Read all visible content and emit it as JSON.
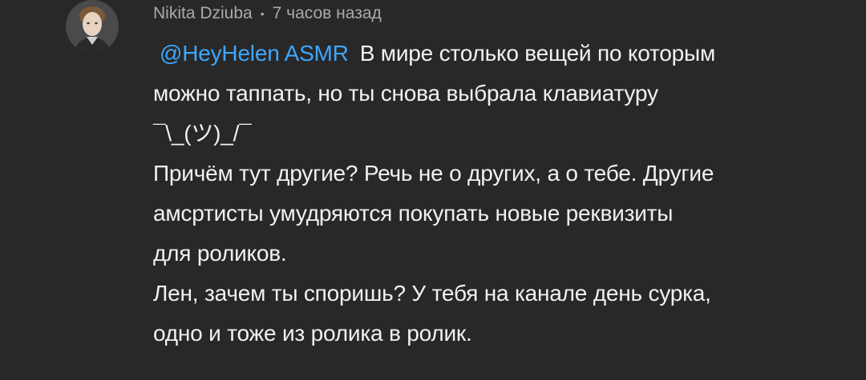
{
  "comment": {
    "author": "Nikita Dziuba",
    "separator": "•",
    "time": "7 часов назад",
    "mention": "@HeyHelen ASMR",
    "lines": [
      "В мире столько вещей по которым",
      "можно таппать, но ты снова выбрала клавиатуру",
      "¯\\_(ツ)_/¯",
      "Причём тут другие? Речь не о других, а о тебе. Другие",
      "амсртисты умудряются покупать новые реквизиты",
      "для роликов.",
      "Лен, зачем ты споришь? У тебя на канале день сурка,",
      "одно и тоже из ролика в ролик."
    ]
  },
  "colors": {
    "background": "#282828",
    "text": "#f1f1f1",
    "meta": "#aaaaaa",
    "mention": "#3ea6ff"
  }
}
